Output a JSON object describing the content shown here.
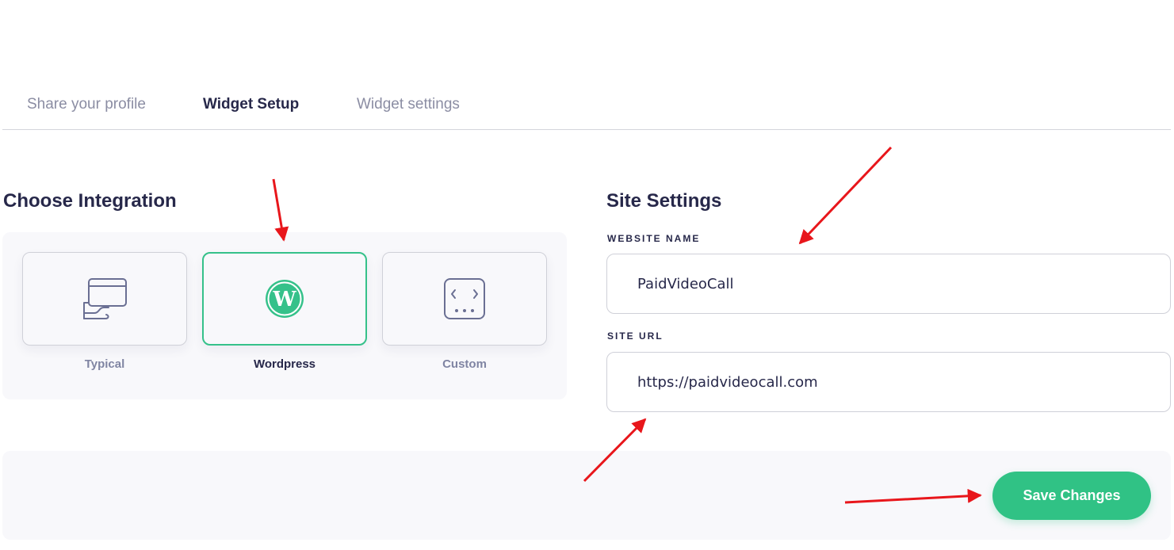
{
  "tabs": [
    {
      "label": "Share your profile",
      "active": false
    },
    {
      "label": "Widget Setup",
      "active": true
    },
    {
      "label": "Widget settings",
      "active": false
    }
  ],
  "integration": {
    "title": "Choose Integration",
    "options": [
      {
        "label": "Typical",
        "icon": "browser-window-icon",
        "selected": false
      },
      {
        "label": "Wordpress",
        "icon": "wordpress-icon",
        "selected": true
      },
      {
        "label": "Custom",
        "icon": "code-brackets-icon",
        "selected": false
      }
    ]
  },
  "site_settings": {
    "title": "Site Settings",
    "website_name_label": "WEBSITE NAME",
    "website_name_value": "PaidVideoCall",
    "site_url_label": "SITE URL",
    "site_url_value": "https://paidvideocall.com"
  },
  "footer": {
    "save_label": "Save Changes"
  },
  "colors": {
    "accent": "#30c285",
    "text": "#27284a",
    "muted": "#8b8da3",
    "annotation": "#e8161b"
  }
}
